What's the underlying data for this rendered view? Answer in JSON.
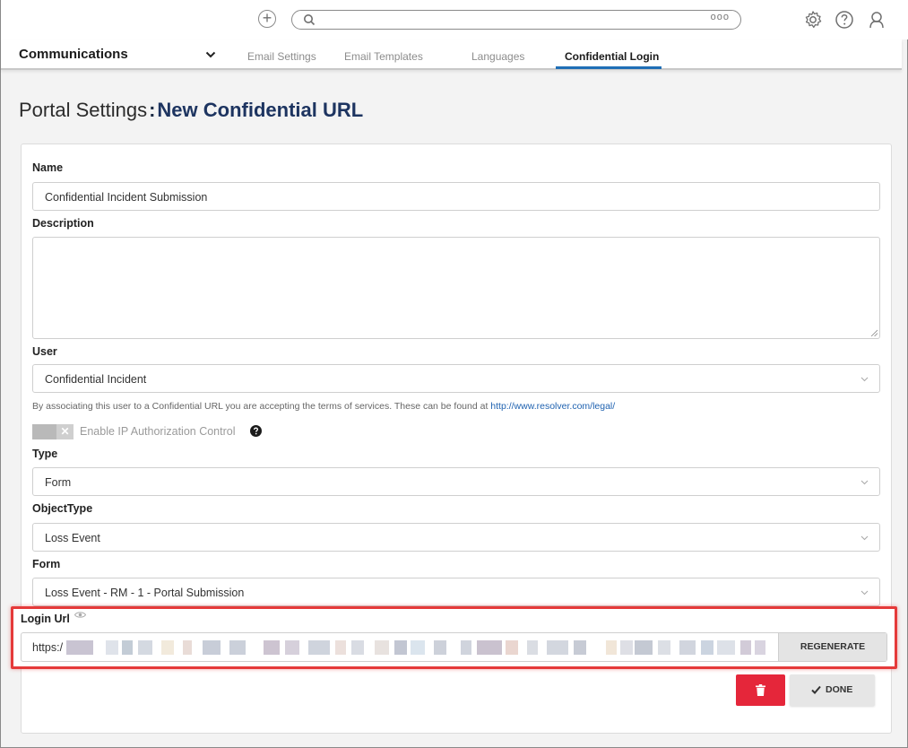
{
  "nav": {
    "app_name": "Communications",
    "tabs": [
      "Email Settings",
      "Email Templates",
      "Languages",
      "Confidential Login"
    ],
    "active_tab": "Confidential Login"
  },
  "topbar": {
    "search_more": "ooo"
  },
  "page": {
    "title_prefix": "Portal Settings",
    "title_separator": ":",
    "title_sub": "New Confidential URL"
  },
  "form": {
    "name_label": "Name",
    "name_value": "Confidential Incident Submission",
    "description_label": "Description",
    "description_value": "",
    "user_label": "User",
    "user_value": "Confidential Incident",
    "terms_text": "By associating this user to a Confidential URL you are accepting the terms of services. These can be found at ",
    "terms_link": "http://www.resolver.com/legal/",
    "ip_control_label": "Enable IP Authorization Control",
    "ip_control_enabled": false,
    "type_label": "Type",
    "type_value": "Form",
    "objecttype_label": "ObjectType",
    "objecttype_value": "Loss Event",
    "form_label": "Form",
    "form_value": "Loss Event - RM - 1 - Portal Submission",
    "login_url_label": "Login Url",
    "login_url_value": "https:/",
    "regenerate_label": "REGENERATE"
  },
  "actions": {
    "done_label": "DONE"
  },
  "colors": {
    "accent": "#1f6fb6",
    "highlight": "#e53a3a",
    "delete": "#e5263a",
    "title_sub": "#1d3460"
  }
}
